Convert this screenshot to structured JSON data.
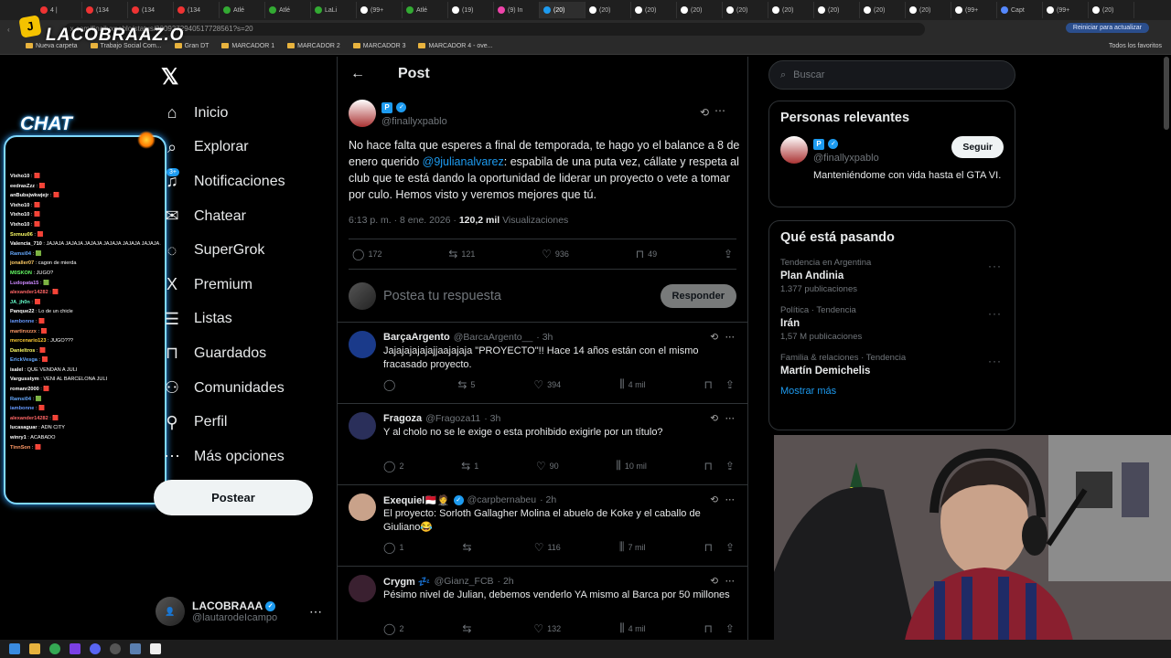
{
  "browser": {
    "tabs": [
      "4 |",
      "(134",
      "(134",
      "(134",
      "Atlé",
      "Atlé",
      "LaLi",
      "(99+",
      "Atlé",
      "(19)",
      "(9) In",
      "(20)",
      "(20)",
      "(20)",
      "(20)",
      "(20)",
      "(20)",
      "(20)",
      "(20)",
      "(20)",
      "(99+",
      "Capt",
      "(99+",
      "(20)"
    ],
    "url": "x.com/finallyxpablo/status/2009372940517728561?s=20",
    "refresh_label": "Reiniciar para actualizar",
    "bookmarks": [
      "Nueva carpeta",
      "Trabajo Social Com...",
      "Gran DT",
      "MARCADOR 1",
      "MARCADOR 2",
      "MARCADOR 3",
      "MARCADOR 4 - ove..."
    ],
    "all_bookmarks": "Todos los favoritos"
  },
  "overlay": {
    "logo_text": "LACOBRAAZ.O",
    "chat_title": "CHAT",
    "chat_messages": [
      {
        "user": "Vixho10",
        "msg": "🟥",
        "color": "#ffffff"
      },
      {
        "user": "eedrasZzz",
        "msg": "🟥",
        "color": "#ffffff"
      },
      {
        "user": "anBubsjwkwjejr",
        "msg": "🟥",
        "color": "#ffffff"
      },
      {
        "user": "Vixho10",
        "msg": "🟥",
        "color": "#ffffff"
      },
      {
        "user": "Vixho10",
        "msg": "🟥",
        "color": "#ffffff"
      },
      {
        "user": "Vixho10",
        "msg": "🟥",
        "color": "#ffffff"
      },
      {
        "user": "Sxmuu06",
        "msg": "🟥",
        "color": "#ffff66"
      },
      {
        "user": "Valencia_710",
        "msg": "JAJAJA JAJAJA JAJAJA JAJAJA JAJAJA JAJAJA JAJAJA JAJAJA",
        "color": "#ffffff"
      },
      {
        "user": "Ramsi04",
        "msg": "🟩",
        "color": "#66aaff"
      },
      {
        "user": "jonaller07",
        "msg": "cagon de mierda",
        "color": "#ffcc66"
      },
      {
        "user": "M0SKON",
        "msg": "JUGO?",
        "color": "#66ff66"
      },
      {
        "user": "Ludopata15",
        "msg": "🟩",
        "color": "#cc88ff"
      },
      {
        "user": "alexander14282",
        "msg": "🟥",
        "color": "#ff6666"
      },
      {
        "user": "JA_jh0n",
        "msg": "🟥",
        "color": "#66ffcc"
      },
      {
        "user": "Panque22",
        "msg": "Lo de un chicle",
        "color": "#ffffff"
      },
      {
        "user": "iambonne",
        "msg": "🟥",
        "color": "#6699ff"
      },
      {
        "user": "martinxzzx",
        "msg": "🟥",
        "color": "#ff9966"
      },
      {
        "user": "mercenario123",
        "msg": "JUGO???",
        "color": "#ffcc33"
      },
      {
        "user": "Danieltros",
        "msg": "🟥",
        "color": "#ffff66"
      },
      {
        "user": "ErickVesga",
        "msg": "🟥",
        "color": "#66aaff"
      },
      {
        "user": "isalel",
        "msg": "QUE VENDAN A JULI",
        "color": "#ffffff"
      },
      {
        "user": "Vargusstym",
        "msg": "VENI AL BARCELONA JULI",
        "color": "#ffffff"
      },
      {
        "user": "romanr2000",
        "msg": "🟥",
        "color": "#ffffff"
      },
      {
        "user": "Ramsi04",
        "msg": "🟩",
        "color": "#66aaff"
      },
      {
        "user": "iambonne",
        "msg": "🟥",
        "color": "#6699ff"
      },
      {
        "user": "alexander14282",
        "msg": "🟥",
        "color": "#ff6666"
      },
      {
        "user": "lucasaguar",
        "msg": "ADN CITY",
        "color": "#ffffff"
      },
      {
        "user": "winry1",
        "msg": "ACABADO",
        "color": "#ffffff"
      },
      {
        "user": "TinnSon",
        "msg": "🟥",
        "color": "#ff9966"
      }
    ]
  },
  "nav": {
    "items": [
      {
        "label": "Inicio",
        "icon": "⌂"
      },
      {
        "label": "Explorar",
        "icon": "⌕"
      },
      {
        "label": "Notificaciones",
        "icon": "♫"
      },
      {
        "label": "Chatear",
        "icon": "✉"
      },
      {
        "label": "SuperGrok",
        "icon": "◌"
      },
      {
        "label": "Premium",
        "icon": "X"
      },
      {
        "label": "Listas",
        "icon": "☰"
      },
      {
        "label": "Guardados",
        "icon": "⊓"
      },
      {
        "label": "Comunidades",
        "icon": "⚇"
      },
      {
        "label": "Perfil",
        "icon": "⚲"
      },
      {
        "label": "Más opciones",
        "icon": "⋯"
      }
    ],
    "notif_badge": "3+",
    "post_button": "Postear",
    "profile_name": "LACOBRAAA",
    "profile_handle": "@lautarodeIcampo"
  },
  "post": {
    "header": "Post",
    "author_badge": "P",
    "author_handle": "@finallyxpablo",
    "text_before": "No hace falta que esperes a final de temporada, te hago yo el balance a 8 de enero querido ",
    "mention": "@9julianalvarez",
    "text_after": ": espabila de una puta vez, cállate y respeta al club que te está dando la oportunidad de liderar un proyecto o vete a tomar por culo. Hemos visto y veremos mejores que tú.",
    "time": "6:13 p. m. · 8 ene. 2026 · ",
    "views_number": "120,2 mil",
    "views_label": " Visualizaciones",
    "replies": "172",
    "reposts": "121",
    "likes": "936",
    "bookmarks": "49",
    "reply_placeholder": "Postea tu respuesta",
    "reply_button": "Responder"
  },
  "replies": [
    {
      "name": "BarçaArgento",
      "handle": "@BarcaArgento__",
      "time": "· 3h",
      "text": "Jajajajajajajjaajajaja \"PROYECTO\"!! Hace 14 años están con el mismo fracasado proyecto.",
      "replies": "",
      "reposts": "5",
      "likes": "394",
      "views": "4 mil",
      "verified": false
    },
    {
      "name": "Fragoza",
      "handle": "@Fragoza11",
      "time": "· 3h",
      "text": "Y al cholo no se le exige o esta prohibido exigirle por un título?",
      "replies": "2",
      "reposts": "1",
      "likes": "90",
      "views": "10 mil",
      "verified": false
    },
    {
      "name": "Exequiel🇲🇨🤵",
      "handle": "@carpbernabeu",
      "time": "· 2h",
      "text": "El proyecto: Sorloth Gallagher Molina el abuelo de Koke y el caballo de Giuliano😂",
      "replies": "1",
      "reposts": "",
      "likes": "116",
      "views": "7 mil",
      "verified": true
    },
    {
      "name": "Crygm 💤",
      "handle": "@Gianz_FCB",
      "time": "· 2h",
      "text": "Pésimo nivel de Julian, debemos venderlo YA mismo al Barca por 50 millones",
      "replies": "2",
      "reposts": "",
      "likes": "132",
      "views": "4 mil",
      "verified": false
    }
  ],
  "sidebar": {
    "search_placeholder": "Buscar",
    "relevant_title": "Personas relevantes",
    "relevant_badge": "P",
    "relevant_handle": "@finallyxpablo",
    "follow_button": "Seguir",
    "relevant_bio": "Manteniéndome con vida hasta el GTA VI.",
    "trends_title": "Qué está pasando",
    "trends": [
      {
        "meta": "Tendencia en Argentina",
        "name": "Plan Andinia",
        "count": "1.377 publicaciones"
      },
      {
        "meta": "Política · Tendencia",
        "name": "Irán",
        "count": "1,57 M publicaciones"
      },
      {
        "meta": "Familia & relaciones · Tendencia",
        "name": "Martín Demichelis",
        "count": ""
      }
    ],
    "show_more": "Mostrar más"
  },
  "colors": {
    "accent": "#1d9bf0",
    "bg": "#000000",
    "border": "#2f3336",
    "muted": "#71767b"
  }
}
